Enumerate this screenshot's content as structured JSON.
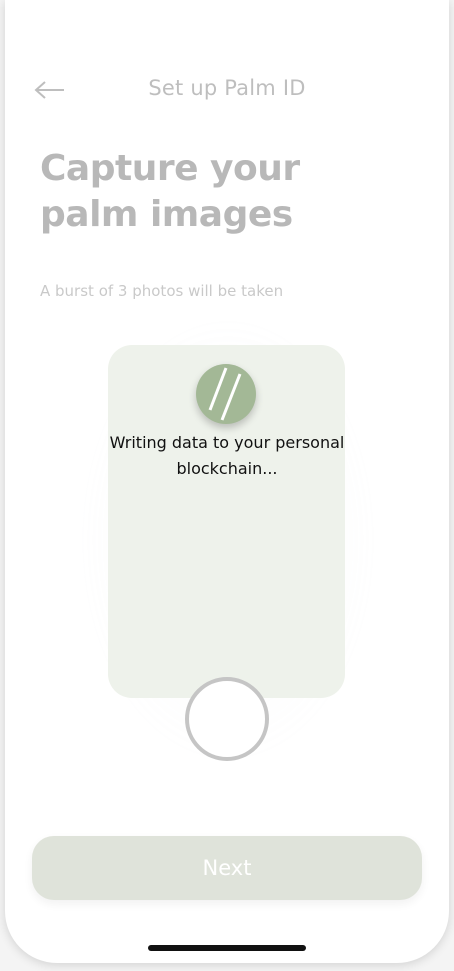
{
  "header": {
    "title": "Set up Palm ID",
    "back_icon": "arrow-left-icon"
  },
  "main": {
    "headline": "Capture your palm images",
    "subtitle": "A burst of 3 photos will be taken",
    "next_label": "Next"
  },
  "overlay": {
    "loading_icon": "slash-lines-icon",
    "message": "Writing data to your personal blockchain..."
  },
  "colors": {
    "accent": "#a3b896",
    "camera_frame": "#c9d6bf",
    "button": "#9ca88a"
  }
}
